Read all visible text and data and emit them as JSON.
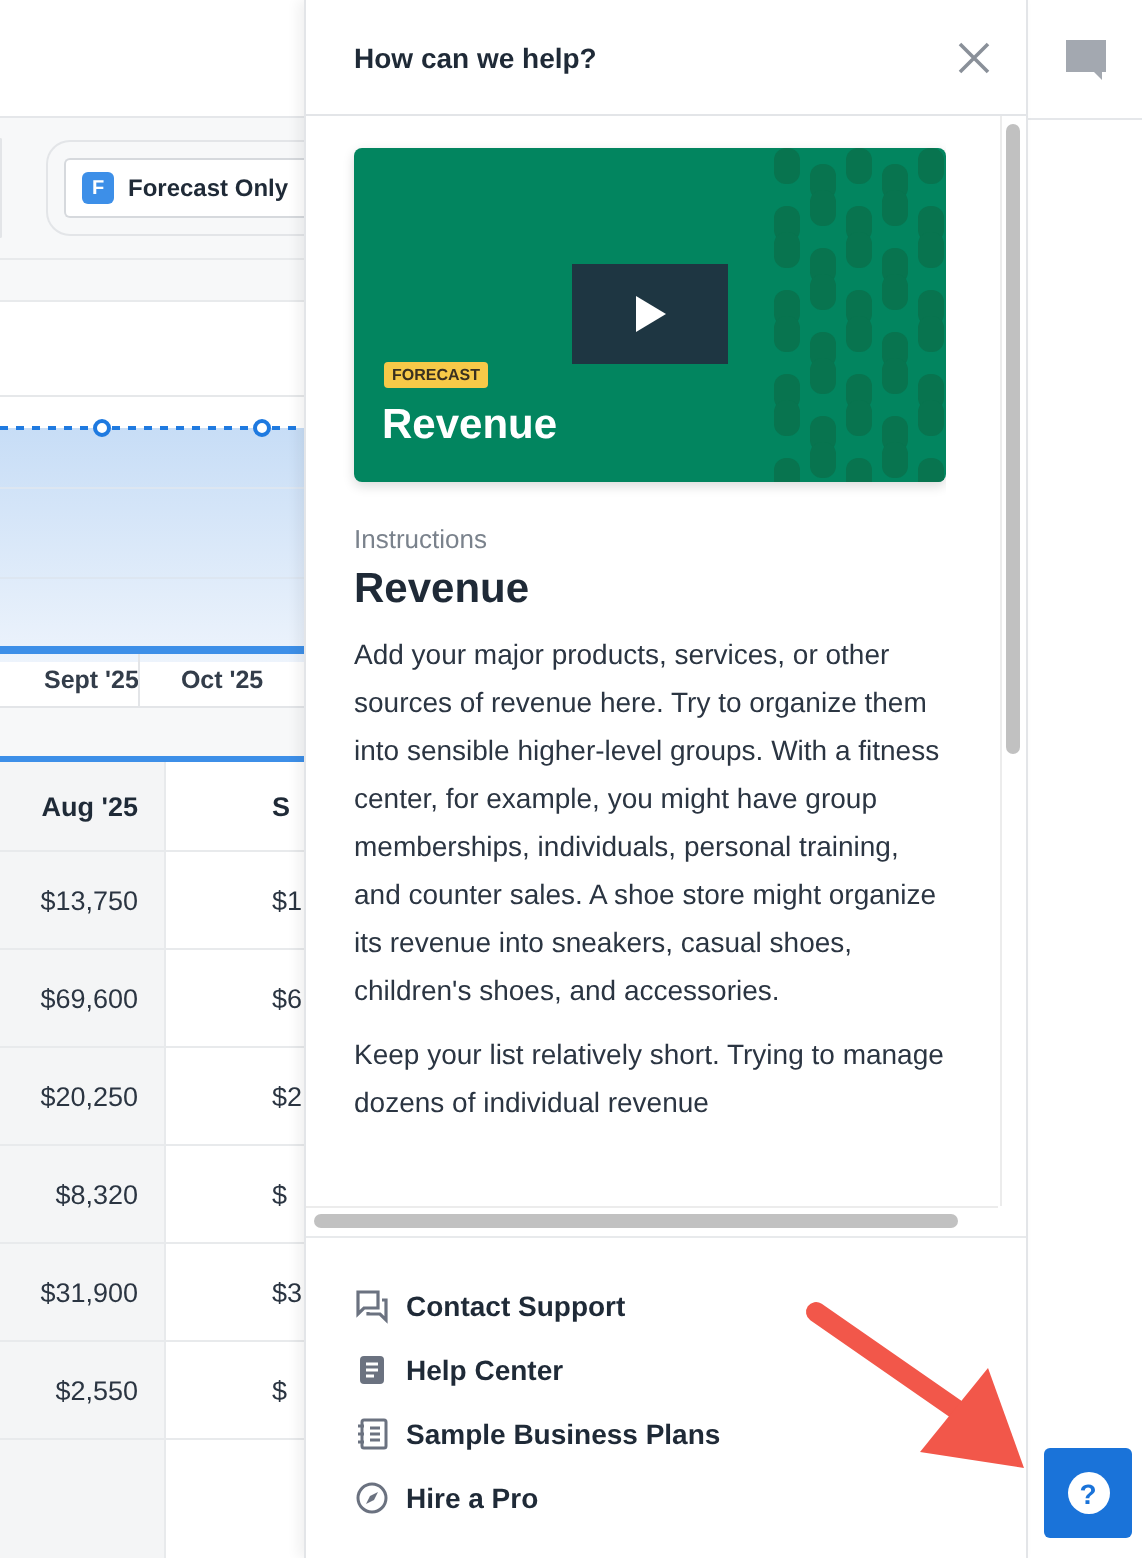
{
  "toolbar": {
    "forecast_button": {
      "badge": "F",
      "label": "Forecast Only"
    }
  },
  "chart": {
    "month_labels": [
      "Sept '25",
      "Oct '25"
    ]
  },
  "table": {
    "columns": [
      "Aug '25",
      "S"
    ],
    "rows": [
      [
        "$13,750",
        "$1"
      ],
      [
        "$69,600",
        "$6"
      ],
      [
        "$20,250",
        "$2"
      ],
      [
        "$8,320",
        "$"
      ],
      [
        "$31,900",
        "$3"
      ],
      [
        "$2,550",
        "$"
      ]
    ]
  },
  "help_panel": {
    "title": "How can we help?",
    "video": {
      "tag": "FORECAST",
      "title": "Revenue"
    },
    "section_label": "Instructions",
    "heading": "Revenue",
    "paragraphs": [
      "Add your major products, services, or other sources of revenue here. Try to organize them into sensible higher-level groups. With a fitness center, for example, you might have group memberships, individuals, personal training, and counter sales. A shoe store might organize its revenue into sneakers, casual shoes, children's shoes, and accessories.",
      "Keep your list relatively short. Trying to manage dozens of individual revenue"
    ],
    "links": [
      {
        "kind": "chat",
        "label": "Contact Support"
      },
      {
        "kind": "doc",
        "label": "Help Center"
      },
      {
        "kind": "notebook",
        "label": "Sample Business Plans"
      },
      {
        "kind": "compass",
        "label": "Hire a Pro"
      }
    ]
  },
  "help_button": {
    "label": "?"
  }
}
